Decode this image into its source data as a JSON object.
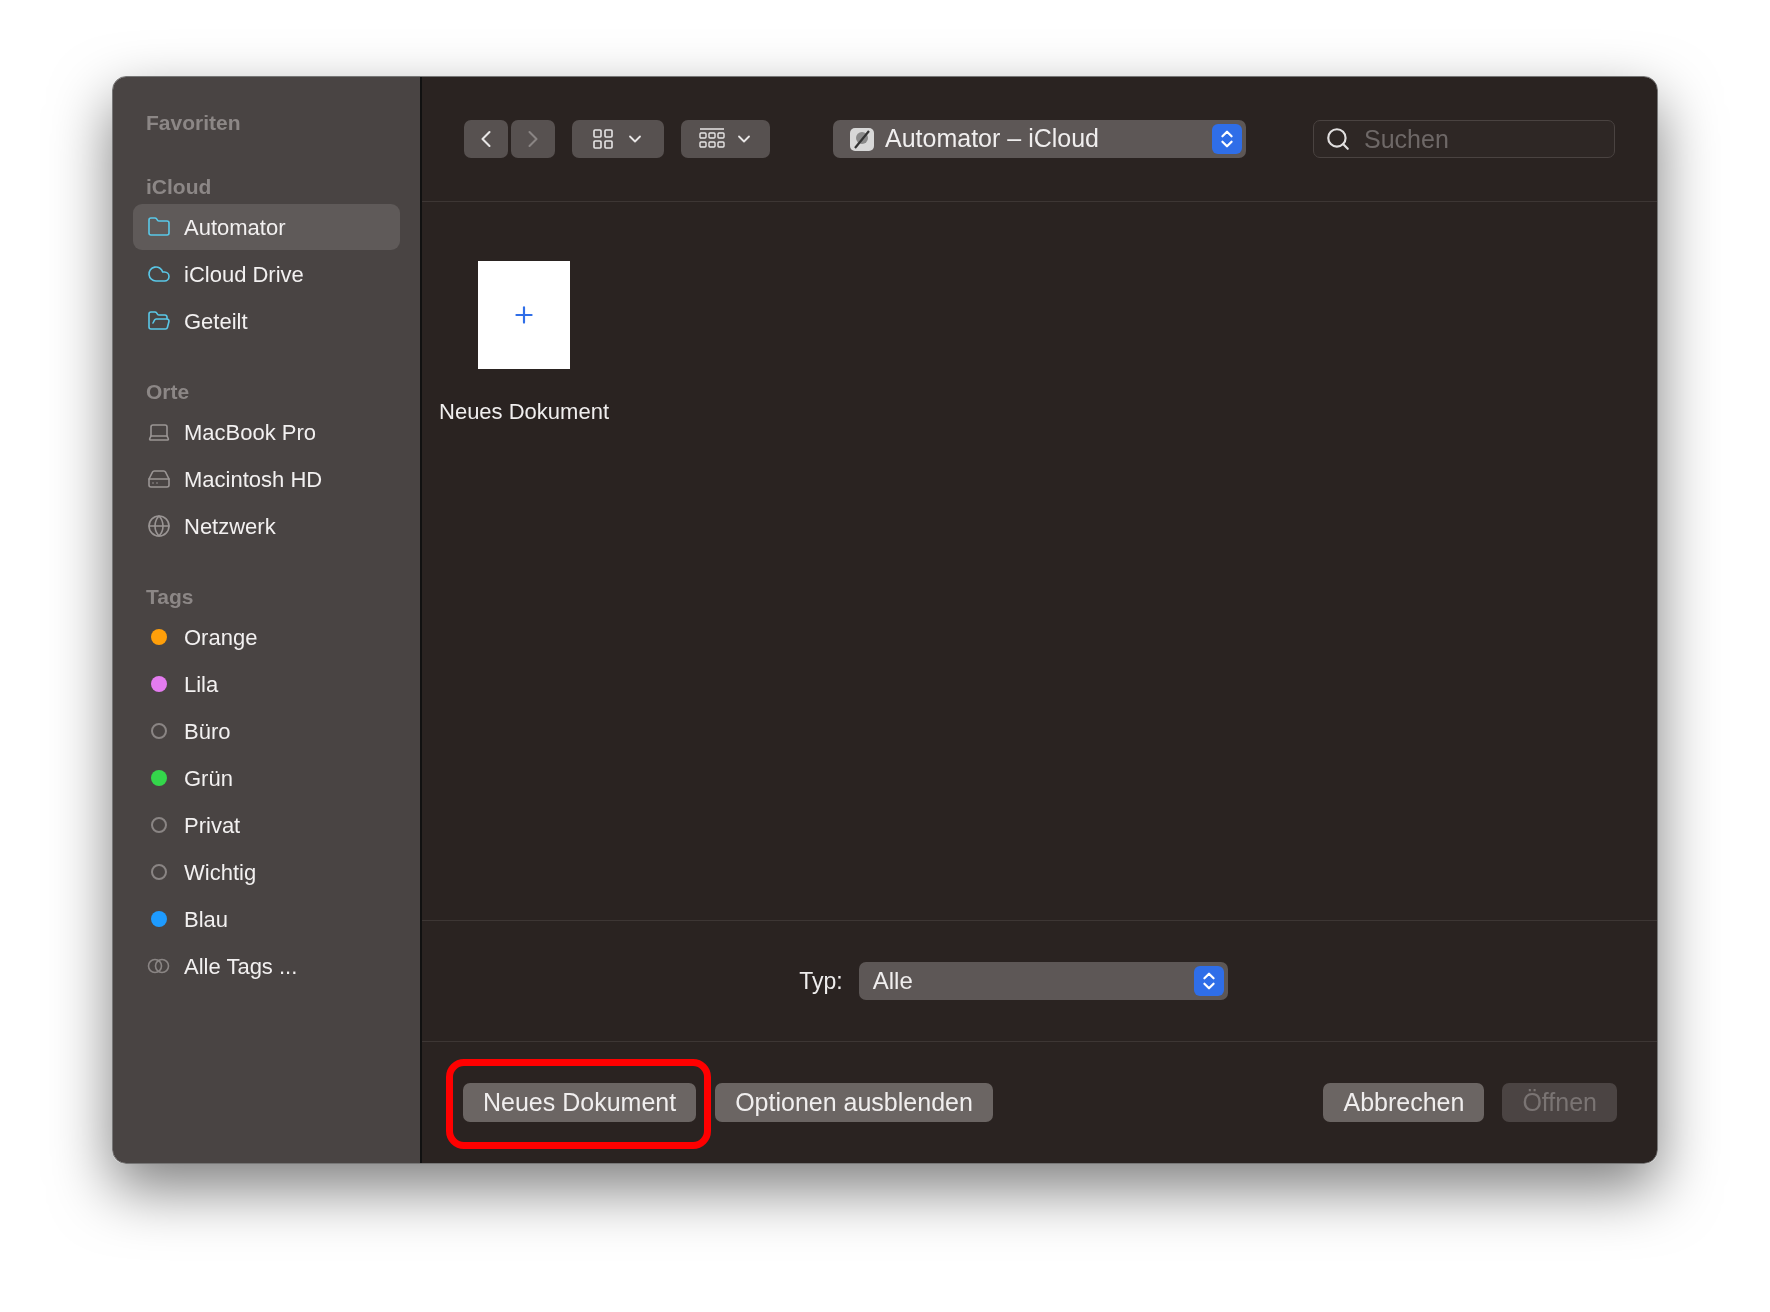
{
  "sidebar": {
    "sections": [
      {
        "title": "Favoriten"
      },
      {
        "title": "iCloud",
        "items": [
          {
            "label": "Automator",
            "kind": "folder",
            "selected": true
          },
          {
            "label": "iCloud Drive",
            "kind": "cloud",
            "selected": false
          },
          {
            "label": "Geteilt",
            "kind": "shared_folder",
            "selected": false
          }
        ]
      },
      {
        "title": "Orte",
        "items": [
          {
            "label": "MacBook Pro",
            "kind": "laptop",
            "selected": false
          },
          {
            "label": "Macintosh HD",
            "kind": "drive",
            "selected": false
          },
          {
            "label": "Netzwerk",
            "kind": "network",
            "selected": false
          }
        ]
      },
      {
        "title": "Tags",
        "items": [
          {
            "label": "Orange",
            "kind": "tag",
            "color": "#ff9f0a",
            "selected": false
          },
          {
            "label": "Lila",
            "kind": "tag",
            "color": "#e47cf0",
            "selected": false
          },
          {
            "label": "Büro",
            "kind": "tag",
            "selected": false
          },
          {
            "label": "Grün",
            "kind": "tag",
            "color": "#34d74b",
            "selected": false
          },
          {
            "label": "Privat",
            "kind": "tag",
            "selected": false
          },
          {
            "label": "Wichtig",
            "kind": "tag",
            "selected": false
          },
          {
            "label": "Blau",
            "kind": "tag",
            "color": "#1e9bff",
            "selected": false
          },
          {
            "label": "Alle Tags ...",
            "kind": "all_tags",
            "selected": false
          }
        ]
      }
    ]
  },
  "toolbar": {
    "back_button": {
      "disabled": false
    },
    "forward_button": {
      "disabled": true
    },
    "location": "Automator – iCloud",
    "search": {
      "placeholder": "Suchen"
    }
  },
  "files": [
    {
      "name": "Neues Dokument",
      "kind": "new_document"
    }
  ],
  "type_filter": {
    "label": "Typ:",
    "value": "Alle"
  },
  "buttons": [
    {
      "label": "Neues Dokument",
      "disabled": false,
      "highlighted": true
    },
    {
      "label": "Optionen ausblenden",
      "disabled": false,
      "highlighted": false
    },
    {
      "label": "Abbrechen",
      "disabled": false,
      "highlighted": false
    },
    {
      "label": "Öffnen",
      "disabled": true,
      "highlighted": false
    }
  ]
}
